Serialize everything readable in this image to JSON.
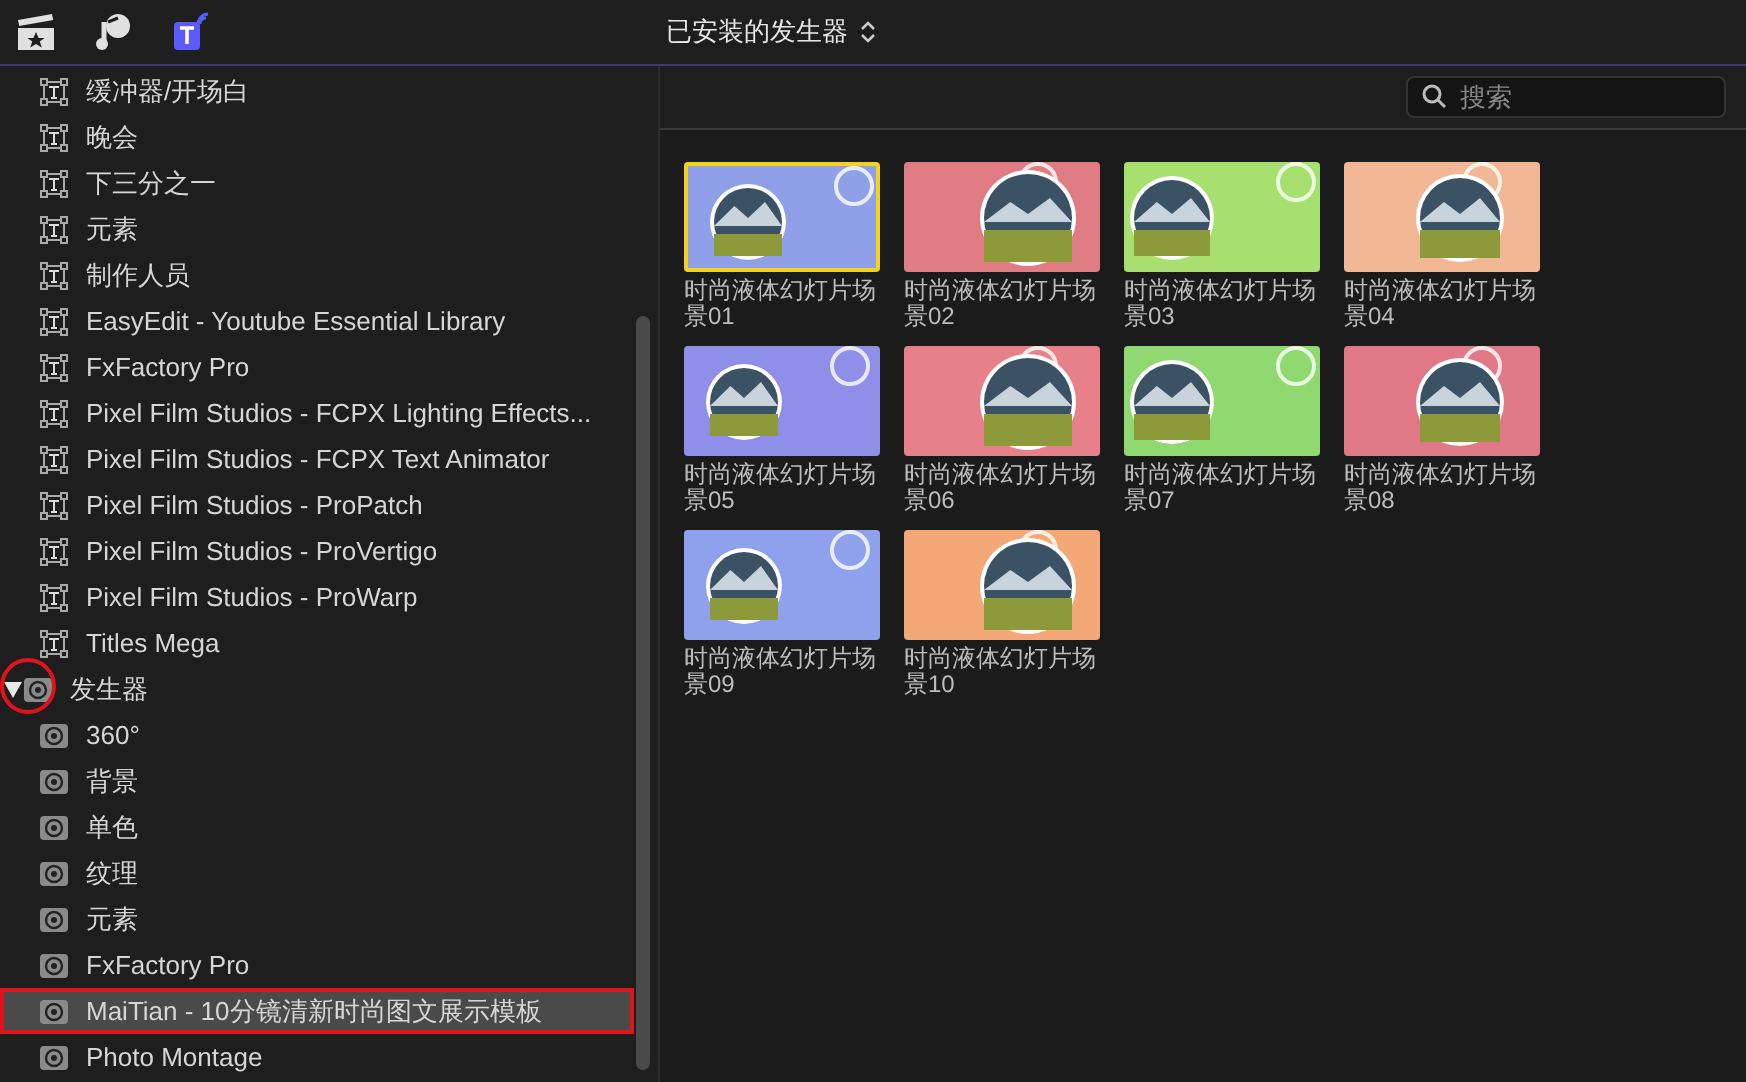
{
  "toolbar": {
    "tabs": [
      {
        "kind": "media",
        "selected": false
      },
      {
        "kind": "audio",
        "selected": false
      },
      {
        "kind": "titles",
        "selected": true
      }
    ]
  },
  "sidebar": {
    "items": [
      {
        "label": "缓冲器/开场白",
        "kind": "title",
        "selected": false
      },
      {
        "label": "晚会",
        "kind": "title",
        "selected": false
      },
      {
        "label": "下三分之一",
        "kind": "title",
        "selected": false
      },
      {
        "label": "元素",
        "kind": "title",
        "selected": false
      },
      {
        "label": "制作人员",
        "kind": "title",
        "selected": false
      },
      {
        "label": "EasyEdit - Youtube Essential Library",
        "kind": "title",
        "selected": false
      },
      {
        "label": "FxFactory Pro",
        "kind": "title",
        "selected": false
      },
      {
        "label": "Pixel Film Studios - FCPX Lighting Effects...",
        "kind": "title",
        "selected": false
      },
      {
        "label": "Pixel Film Studios - FCPX Text Animator",
        "kind": "title",
        "selected": false
      },
      {
        "label": "Pixel Film Studios - ProPatch",
        "kind": "title",
        "selected": false
      },
      {
        "label": "Pixel Film Studios - ProVertigo",
        "kind": "title",
        "selected": false
      },
      {
        "label": "Pixel Film Studios - ProWarp",
        "kind": "title",
        "selected": false
      },
      {
        "label": "Titles Mega",
        "kind": "title",
        "selected": false
      },
      {
        "label": "发生器",
        "kind": "generator",
        "selected": false,
        "expanded": true,
        "circled": true,
        "children": [
          {
            "label": "360°",
            "kind": "generator",
            "selected": false
          },
          {
            "label": "背景",
            "kind": "generator",
            "selected": false
          },
          {
            "label": "单色",
            "kind": "generator",
            "selected": false
          },
          {
            "label": "纹理",
            "kind": "generator",
            "selected": false
          },
          {
            "label": "元素",
            "kind": "generator",
            "selected": false
          },
          {
            "label": "FxFactory Pro",
            "kind": "generator",
            "selected": false
          },
          {
            "label": "MaiTian - 10分镜清新时尚图文展示模板",
            "kind": "generator",
            "selected": true,
            "outlined": true
          },
          {
            "label": "Photo Montage",
            "kind": "generator",
            "selected": false
          }
        ]
      }
    ]
  },
  "browser": {
    "title": "已安装的发生器",
    "search": {
      "placeholder": "搜索"
    },
    "items": [
      {
        "label": "时尚液体幻灯片场景01",
        "color": "#8fa0e8",
        "selected": true
      },
      {
        "label": "时尚液体幻灯片场景02",
        "color": "#e07c84",
        "selected": false
      },
      {
        "label": "时尚液体幻灯片场景03",
        "color": "#a8e070",
        "selected": false
      },
      {
        "label": "时尚液体幻灯片场景04",
        "color": "#f2b896",
        "selected": false
      },
      {
        "label": "时尚液体幻灯片场景05",
        "color": "#8f8ee8",
        "selected": false
      },
      {
        "label": "时尚液体幻灯片场景06",
        "color": "#e8808a",
        "selected": false
      },
      {
        "label": "时尚液体幻灯片场景07",
        "color": "#90d870",
        "selected": false
      },
      {
        "label": "时尚液体幻灯片场景08",
        "color": "#e07888",
        "selected": false
      },
      {
        "label": "时尚液体幻灯片场景09",
        "color": "#8fa0ec",
        "selected": false
      },
      {
        "label": "时尚液体幻灯片场景10",
        "color": "#f4a878",
        "selected": false
      }
    ]
  }
}
